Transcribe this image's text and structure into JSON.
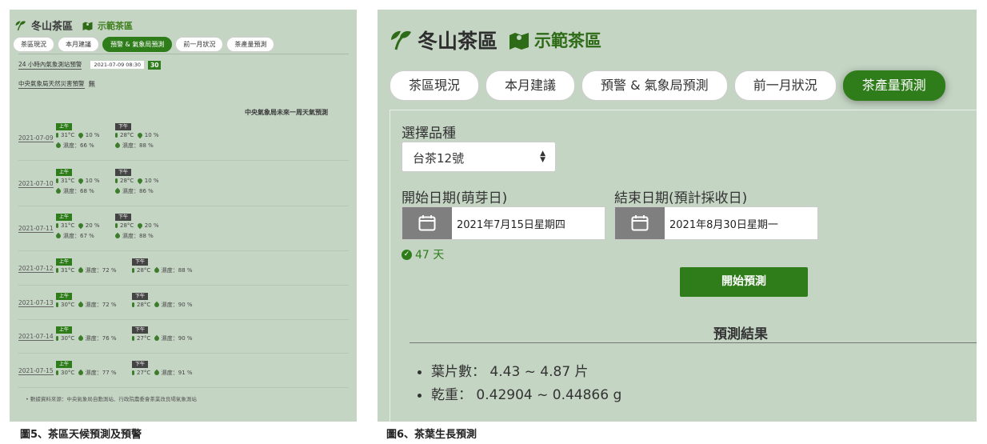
{
  "left": {
    "title": "冬山茶區",
    "subtitle": "示範茶區",
    "tabs": [
      {
        "label": "茶區現況",
        "active": false
      },
      {
        "label": "本月建議",
        "active": false
      },
      {
        "label": "預警 & 氣象局預測",
        "active": true
      },
      {
        "label": "前一月狀況",
        "active": false
      },
      {
        "label": "茶產量預測",
        "active": false
      }
    ],
    "warning_24h_label": "24 小時內氣象測站預警",
    "warning_timestamp": "2021-07-09 08:30",
    "warning_count": "30",
    "disaster_label": "中央氣象局天然災害預警",
    "disaster_value": "無",
    "cwb_title": "中央氣象局未來一周天氣預測",
    "am_label": "上午",
    "pm_label": "下午",
    "days": [
      {
        "date": "2021-07-09",
        "am": [
          "31°C",
          "10 %",
          "濕度：66 %"
        ],
        "pm": [
          "28°C",
          "10 %",
          "濕度：88 %"
        ]
      },
      {
        "date": "2021-07-10",
        "am": [
          "31°C",
          "10 %",
          "濕度：68 %"
        ],
        "pm": [
          "28°C",
          "10 %",
          "濕度：86 %"
        ]
      },
      {
        "date": "2021-07-11",
        "am": [
          "31°C",
          "20 %",
          "濕度：67 %"
        ],
        "pm": [
          "28°C",
          "20 %",
          "濕度：88 %"
        ]
      },
      {
        "date": "2021-07-12",
        "am": [
          "31°C",
          "濕度：72 %"
        ],
        "pm": [
          "28°C",
          "濕度：88 %"
        ]
      },
      {
        "date": "2021-07-13",
        "am": [
          "30°C",
          "濕度：72 %"
        ],
        "pm": [
          "28°C",
          "濕度：90 %"
        ]
      },
      {
        "date": "2021-07-14",
        "am": [
          "30°C",
          "濕度：76 %"
        ],
        "pm": [
          "27°C",
          "濕度：90 %"
        ]
      },
      {
        "date": "2021-07-15",
        "am": [
          "30°C",
          "濕度：77 %"
        ],
        "pm": [
          "27°C",
          "濕度：91 %"
        ]
      }
    ],
    "source": "數據資料來源：中央氣象局自動測站、行政院農委會茶業改良場氣象測站"
  },
  "right": {
    "title": "冬山茶區",
    "subtitle": "示範茶區",
    "tabs": [
      {
        "label": "茶區現況",
        "active": false
      },
      {
        "label": "本月建議",
        "active": false
      },
      {
        "label": "預警 & 氣象局預測",
        "active": false
      },
      {
        "label": "前一月狀況",
        "active": false
      },
      {
        "label": "茶產量預測",
        "active": true
      }
    ],
    "variety_label": "選擇品種",
    "variety_value": "台茶12號",
    "start_label": "開始日期(萌芽日)",
    "start_value": "2021年7月15日星期四",
    "end_label": "結束日期(預計採收日)",
    "end_value": "2021年8月30日星期一",
    "duration": "47 天",
    "predict_button": "開始預測",
    "result_title": "預測結果",
    "results": [
      "葉片數： 4.43 ~ 4.87 片",
      "乾重： 0.42904 ~ 0.44866 g"
    ]
  },
  "captions": {
    "fig5": "圖5、茶區天候預測及預警",
    "fig6": "圖6、茶葉生長預測"
  },
  "colors": {
    "panel_bg": "#c5d5c4",
    "accent_green": "#2e7d1a",
    "date_icon_bg": "#7f7f7f"
  },
  "icons": {
    "brand": "tea-leaf-icon",
    "demo_area": "map-icon",
    "calendar": "calendar-icon",
    "temperature": "thermometer-icon",
    "rain": "rain-icon",
    "humidity": "humidity-icon",
    "select": "sort-arrows-icon",
    "ok": "check-circle-icon"
  }
}
